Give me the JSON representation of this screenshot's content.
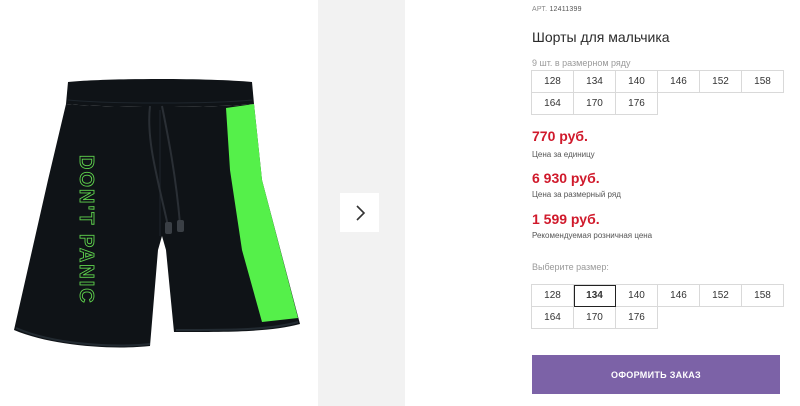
{
  "product": {
    "art_label": "АРТ.",
    "art_number": "12411399",
    "title": "Шорты для мальчика",
    "size_note": "9 шт. в размерном ряду",
    "size_row": [
      "128",
      "134",
      "140",
      "146",
      "152",
      "158",
      "164",
      "170",
      "176"
    ]
  },
  "prices": [
    {
      "value": "770 руб.",
      "label": "Цена за единицу"
    },
    {
      "value": "6 930 руб.",
      "label": "Цена за размерный ряд"
    },
    {
      "value": "1 599 руб.",
      "label": "Рекомендуемая розничная цена"
    }
  ],
  "size_picker": {
    "label": "Выберите размер:",
    "sizes": [
      "128",
      "134",
      "140",
      "146",
      "152",
      "158",
      "164",
      "170",
      "176"
    ],
    "selected": "134"
  },
  "order_button_label": "ОФОРМИТЬ ЗАКАЗ",
  "image": {
    "print_text": "DON'T PANIC",
    "colors": {
      "fabric": "#0f1317",
      "accent": "#55f04a",
      "print": "#5fd34d"
    }
  },
  "colors": {
    "price": "#d0192b",
    "button": "#7c62a7"
  },
  "icons": {
    "next": "chevron-right-icon"
  }
}
